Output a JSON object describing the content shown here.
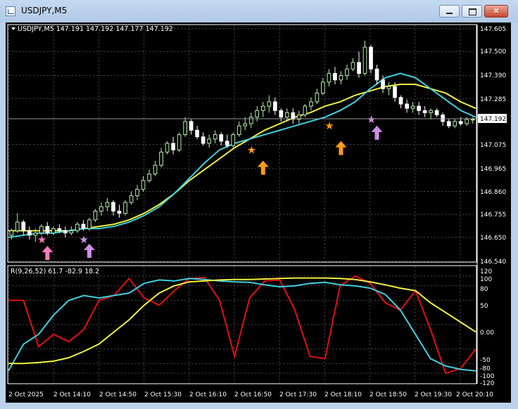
{
  "window": {
    "title": "USDJPY,M5",
    "icon": "chart-window-icon",
    "controls": [
      "minimize-icon",
      "maximize-icon",
      "close-icon"
    ]
  },
  "colors": {
    "background": "#000000",
    "grid": "#4a4a4a",
    "axis_text": "#ffffff",
    "bull_candle": "#b5f2a8",
    "bear_candle": "#ffffff",
    "ma_fast": "#3fd0e0",
    "ma_slow": "#f0f040",
    "osc_red": "#e01010",
    "osc_cyan": "#3fd0e0",
    "osc_yellow": "#f0f040",
    "arrow_pink": "#ff7ab8",
    "arrow_violet": "#d08ee8",
    "arrow_orange": "#ff9a1a",
    "price_marker_bg": "#ffffff"
  },
  "main_panel": {
    "info_label": "USDJPY,M5  147.191 147.192 147.177 147.192",
    "price_ticks": [
      "147.605",
      "147.500",
      "147.390",
      "147.285",
      "147.075",
      "146.965",
      "146.860",
      "146.755",
      "146.650",
      "146.540"
    ],
    "current_price": "147.192"
  },
  "sub_panel": {
    "info_label": "R(9,26,52) 61.7 -82.9 18.2",
    "level_ticks": [
      "120",
      "100",
      "80",
      "50",
      "0.00",
      "-50",
      "-80",
      "-100",
      "-120"
    ]
  },
  "time_labels": [
    "2 Oct 2025",
    "2 Oct 14:10",
    "2 Oct 14:50",
    "2 Oct 15:30",
    "2 Oct 16:10",
    "2 Oct 16:50",
    "2 Oct 17:30",
    "2 Oct 18:10",
    "2 Oct 18:50",
    "2 Oct 19:30",
    "2 Oct 20:10"
  ],
  "chart_data": [
    {
      "type": "candlestick",
      "title": "USDJPY,M5",
      "x_range": [
        "2 Oct 2025 13:30",
        "2 Oct 2025 20:20"
      ],
      "ylim": [
        146.54,
        147.62
      ],
      "grid": true,
      "candles": [
        [
          146.66,
          146.69,
          146.64,
          146.68
        ],
        [
          146.68,
          146.76,
          146.67,
          146.72
        ],
        [
          146.72,
          146.73,
          146.66,
          146.68
        ],
        [
          146.68,
          146.7,
          146.64,
          146.66
        ],
        [
          146.66,
          146.69,
          146.63,
          146.67
        ],
        [
          146.67,
          146.71,
          146.66,
          146.7
        ],
        [
          146.7,
          146.72,
          146.66,
          146.67
        ],
        [
          146.67,
          146.7,
          146.66,
          146.69
        ],
        [
          146.69,
          146.71,
          146.67,
          146.68
        ],
        [
          146.68,
          146.7,
          146.65,
          146.67
        ],
        [
          146.67,
          146.7,
          146.66,
          146.68
        ],
        [
          146.68,
          146.72,
          146.67,
          146.71
        ],
        [
          146.71,
          146.73,
          146.68,
          146.69
        ],
        [
          146.69,
          146.74,
          146.68,
          146.73
        ],
        [
          146.73,
          146.78,
          146.72,
          146.77
        ],
        [
          146.77,
          146.81,
          146.75,
          146.79
        ],
        [
          146.79,
          146.83,
          146.77,
          146.81
        ],
        [
          146.81,
          146.82,
          146.75,
          146.77
        ],
        [
          146.77,
          146.8,
          146.74,
          146.76
        ],
        [
          146.76,
          146.82,
          146.75,
          146.81
        ],
        [
          146.81,
          146.86,
          146.8,
          146.84
        ],
        [
          146.84,
          146.89,
          146.82,
          146.87
        ],
        [
          146.87,
          146.93,
          146.86,
          146.91
        ],
        [
          146.91,
          146.96,
          146.9,
          146.94
        ],
        [
          146.94,
          147.0,
          146.93,
          146.98
        ],
        [
          146.98,
          147.06,
          146.97,
          147.04
        ],
        [
          147.04,
          147.09,
          147.03,
          147.08
        ],
        [
          147.08,
          147.11,
          147.03,
          147.05
        ],
        [
          147.05,
          147.13,
          147.04,
          147.12
        ],
        [
          147.12,
          147.2,
          147.11,
          147.18
        ],
        [
          147.18,
          147.19,
          147.12,
          147.14
        ],
        [
          147.14,
          147.16,
          147.1,
          147.11
        ],
        [
          147.11,
          147.13,
          147.07,
          147.08
        ],
        [
          147.08,
          147.12,
          147.06,
          147.1
        ],
        [
          147.1,
          147.14,
          147.08,
          147.12
        ],
        [
          147.12,
          147.13,
          147.07,
          147.09
        ],
        [
          147.09,
          147.12,
          147.06,
          147.07
        ],
        [
          147.07,
          147.13,
          147.06,
          147.12
        ],
        [
          147.12,
          147.18,
          147.11,
          147.16
        ],
        [
          147.16,
          147.2,
          147.14,
          147.17
        ],
        [
          147.17,
          147.22,
          147.15,
          147.2
        ],
        [
          147.2,
          147.25,
          147.18,
          147.23
        ],
        [
          147.23,
          147.27,
          147.2,
          147.25
        ],
        [
          147.25,
          147.3,
          147.22,
          147.27
        ],
        [
          147.27,
          147.29,
          147.21,
          147.23
        ],
        [
          147.23,
          147.24,
          147.18,
          147.2
        ],
        [
          147.2,
          147.24,
          147.18,
          147.22
        ],
        [
          147.22,
          147.24,
          147.17,
          147.19
        ],
        [
          147.19,
          147.23,
          147.17,
          147.21
        ],
        [
          147.21,
          147.26,
          147.2,
          147.25
        ],
        [
          147.25,
          147.29,
          147.23,
          147.27
        ],
        [
          147.27,
          147.33,
          147.26,
          147.31
        ],
        [
          147.31,
          147.38,
          147.3,
          147.36
        ],
        [
          147.36,
          147.42,
          147.34,
          147.4
        ],
        [
          147.4,
          147.43,
          147.35,
          147.37
        ],
        [
          147.37,
          147.41,
          147.35,
          147.39
        ],
        [
          147.39,
          147.44,
          147.37,
          147.42
        ],
        [
          147.42,
          147.47,
          147.41,
          147.45
        ],
        [
          147.45,
          147.5,
          147.38,
          147.4
        ],
        [
          147.4,
          147.55,
          147.39,
          147.52
        ],
        [
          147.52,
          147.53,
          147.4,
          147.42
        ],
        [
          147.42,
          147.44,
          147.35,
          147.37
        ],
        [
          147.37,
          147.39,
          147.31,
          147.33
        ],
        [
          147.33,
          147.36,
          147.3,
          147.34
        ],
        [
          147.34,
          147.36,
          147.27,
          147.29
        ],
        [
          147.29,
          147.3,
          147.24,
          147.26
        ],
        [
          147.26,
          147.28,
          147.22,
          147.24
        ],
        [
          147.24,
          147.27,
          147.22,
          147.25
        ],
        [
          147.25,
          147.27,
          147.21,
          147.23
        ],
        [
          147.23,
          147.25,
          147.2,
          147.22
        ],
        [
          147.22,
          147.24,
          147.19,
          147.23
        ],
        [
          147.23,
          147.24,
          147.2,
          147.21
        ],
        [
          147.21,
          147.22,
          147.16,
          147.18
        ],
        [
          147.18,
          147.19,
          147.15,
          147.16
        ],
        [
          147.16,
          147.19,
          147.15,
          147.18
        ],
        [
          147.18,
          147.2,
          147.16,
          147.17
        ],
        [
          147.17,
          147.2,
          147.16,
          147.19
        ],
        [
          147.19,
          147.2,
          147.17,
          147.19
        ]
      ],
      "ma_fast": [
        146.65,
        146.66,
        146.67,
        146.67,
        146.68,
        146.69,
        146.69,
        146.7,
        146.72,
        146.75,
        146.79,
        146.85,
        146.92,
        146.99,
        147.05,
        147.08,
        147.1,
        147.12,
        147.14,
        147.16,
        147.18,
        147.2,
        147.23,
        147.27,
        147.33,
        147.38,
        147.4,
        147.38,
        147.33,
        147.28,
        147.23,
        147.2
      ],
      "ma_slow": [
        146.68,
        146.68,
        146.68,
        146.68,
        146.68,
        146.69,
        146.7,
        146.71,
        146.73,
        146.76,
        146.8,
        146.85,
        146.91,
        146.96,
        147.01,
        147.06,
        147.1,
        147.14,
        147.17,
        147.2,
        147.22,
        147.25,
        147.27,
        147.3,
        147.32,
        147.34,
        147.35,
        147.35,
        147.33,
        147.31,
        147.27,
        147.24
      ],
      "signals": [
        {
          "candle": 5,
          "type": "star",
          "color": "pink",
          "price": 146.64
        },
        {
          "candle": 6,
          "type": "up-arrow",
          "color": "pink",
          "price": 146.63
        },
        {
          "candle": 12,
          "type": "star",
          "color": "violet",
          "price": 146.64
        },
        {
          "candle": 13,
          "type": "up-arrow",
          "color": "violet",
          "price": 146.64
        },
        {
          "candle": 40,
          "type": "star",
          "color": "orange",
          "price": 147.05
        },
        {
          "candle": 42,
          "type": "up-arrow",
          "color": "orange",
          "price": 147.02
        },
        {
          "candle": 53,
          "type": "star",
          "color": "orange",
          "price": 147.16
        },
        {
          "candle": 55,
          "type": "up-arrow",
          "color": "orange",
          "price": 147.11
        },
        {
          "candle": 60,
          "type": "star",
          "color": "violet",
          "price": 147.19
        },
        {
          "candle": 61,
          "type": "up-arrow",
          "color": "violet",
          "price": 147.18
        }
      ]
    },
    {
      "type": "line",
      "title": "R(9,26,52)",
      "ylim": [
        -120,
        120
      ],
      "grid": true,
      "x_points": 32,
      "series": [
        {
          "name": "",
          "color": "red",
          "values": [
            50,
            50,
            -45,
            -20,
            -35,
            -10,
            50,
            60,
            95,
            55,
            40,
            70,
            95,
            97,
            50,
            -65,
            55,
            90,
            92,
            30,
            -65,
            -70,
            80,
            100,
            85,
            45,
            30,
            70,
            -10,
            -100,
            -90,
            -50
          ]
        },
        {
          "name": "",
          "color": "cyan",
          "values": [
            -95,
            -40,
            -20,
            20,
            50,
            60,
            55,
            60,
            65,
            85,
            92,
            90,
            95,
            93,
            90,
            88,
            87,
            82,
            78,
            80,
            85,
            87,
            82,
            80,
            75,
            62,
            30,
            -20,
            -70,
            -85,
            -92,
            -95
          ]
        },
        {
          "name": "",
          "color": "yellow",
          "values": [
            -80,
            -80,
            -78,
            -75,
            -68,
            -55,
            -40,
            -15,
            10,
            40,
            65,
            80,
            88,
            90,
            92,
            93,
            93,
            94,
            95,
            96,
            96,
            96,
            95,
            93,
            88,
            82,
            75,
            70,
            45,
            25,
            5,
            -15
          ]
        }
      ],
      "last_values": [
        "61.7",
        "-82.9",
        "18.2"
      ]
    }
  ]
}
